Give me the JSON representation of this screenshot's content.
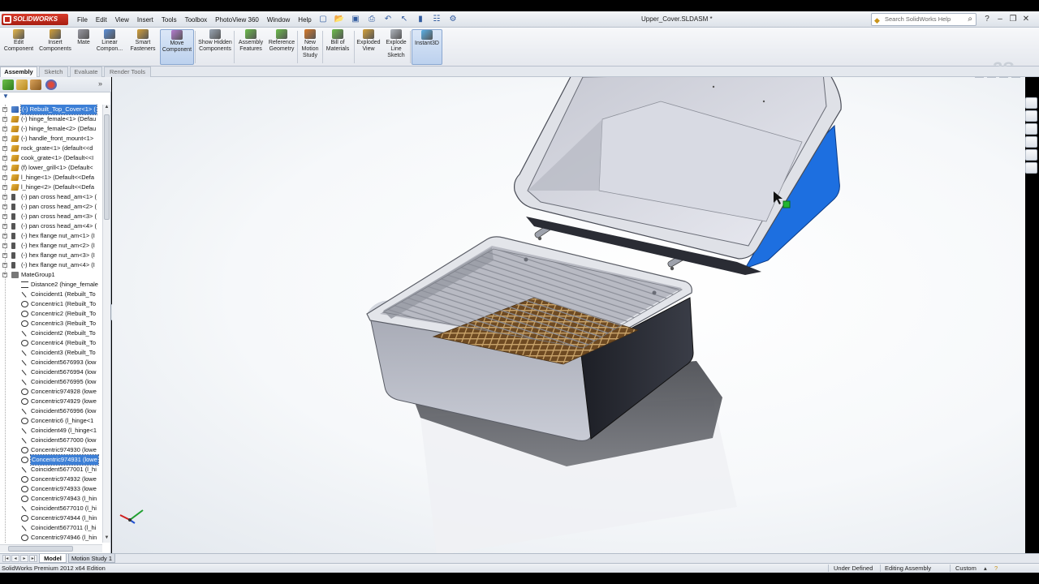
{
  "app": {
    "logo_text": "SOLIDWORKS",
    "document_title": "Upper_Cover.SLDASM *"
  },
  "menu": {
    "items": [
      "File",
      "Edit",
      "View",
      "Insert",
      "Tools",
      "Toolbox",
      "PhotoView 360",
      "Window",
      "Help"
    ]
  },
  "search": {
    "placeholder": "Search SolidWorks Help"
  },
  "command_manager": {
    "buttons": [
      {
        "label": "Edit Component",
        "icon": "edit-component-icon"
      },
      {
        "label": "Insert Components",
        "icon": "insert-components-icon"
      },
      {
        "label": "Mate",
        "icon": "mate-icon"
      },
      {
        "label": "Linear Compon...",
        "icon": "linear-pattern-icon"
      },
      {
        "label": "Smart Fasteners",
        "icon": "smart-fasteners-icon"
      },
      {
        "label": "Move Component",
        "icon": "move-component-icon"
      },
      {
        "label": "Show Hidden Components",
        "icon": "show-hidden-icon"
      },
      {
        "label": "Assembly Features",
        "icon": "assembly-features-icon"
      },
      {
        "label": "Reference Geometry",
        "icon": "reference-geometry-icon"
      },
      {
        "label": "New Motion Study",
        "icon": "motion-study-icon"
      },
      {
        "label": "Bill of Materials",
        "icon": "bom-icon"
      },
      {
        "label": "Exploded View",
        "icon": "exploded-view-icon"
      },
      {
        "label": "Explode Line Sketch",
        "icon": "explode-line-icon"
      },
      {
        "label": "Instant3D",
        "icon": "instant3d-icon"
      }
    ],
    "tabs": [
      "Assembly",
      "Sketch",
      "Evaluate",
      "Render Tools"
    ],
    "active_tab": "Assembly"
  },
  "feature_tree": {
    "rows": [
      {
        "label": "(-) Rebuilt_Top_Cover<1> (",
        "kind": "comp-blue",
        "depth": 1,
        "selected": true
      },
      {
        "label": "(-) hinge_female<1> (Defau",
        "kind": "comp",
        "depth": 1
      },
      {
        "label": "(-) hinge_female<2> (Defau",
        "kind": "comp",
        "depth": 1
      },
      {
        "label": "(-) handle_front_mount<1>",
        "kind": "comp",
        "depth": 1
      },
      {
        "label": "rock_grate<1> (default<<d",
        "kind": "comp",
        "depth": 1
      },
      {
        "label": "cook_grate<1> (Default<<I",
        "kind": "comp",
        "depth": 1
      },
      {
        "label": "(f) lower_grill<1> (Default<",
        "kind": "comp",
        "depth": 1
      },
      {
        "label": "l_hinge<1> (Default<<Defa",
        "kind": "comp",
        "depth": 1
      },
      {
        "label": "l_hinge<2> (Default<<Defa",
        "kind": "comp",
        "depth": 1
      },
      {
        "label": "(-) pan cross head_am<1> (",
        "kind": "screw",
        "depth": 1
      },
      {
        "label": "(-) pan cross head_am<2> (",
        "kind": "screw",
        "depth": 1
      },
      {
        "label": "(-) pan cross head_am<3> (",
        "kind": "screw",
        "depth": 1
      },
      {
        "label": "(-) pan cross head_am<4> (",
        "kind": "screw",
        "depth": 1
      },
      {
        "label": "(-) hex flange nut_am<1> (I",
        "kind": "screw",
        "depth": 1
      },
      {
        "label": "(-) hex flange nut_am<2> (I",
        "kind": "screw",
        "depth": 1
      },
      {
        "label": "(-) hex flange nut_am<3> (I",
        "kind": "screw",
        "depth": 1
      },
      {
        "label": "(-) hex flange nut_am<4> (I",
        "kind": "screw",
        "depth": 1
      },
      {
        "label": "MateGroup1",
        "kind": "group",
        "depth": 0
      },
      {
        "label": "Distance2 (hinge_female",
        "kind": "dist",
        "depth": 2
      },
      {
        "label": "Coincident1 (Rebuilt_To",
        "kind": "coin",
        "depth": 2
      },
      {
        "label": "Concentric1 (Rebuilt_To",
        "kind": "conc",
        "depth": 2
      },
      {
        "label": "Concentric2 (Rebuilt_To",
        "kind": "conc",
        "depth": 2
      },
      {
        "label": "Concentric3 (Rebuilt_To",
        "kind": "conc",
        "depth": 2
      },
      {
        "label": "Coincident2 (Rebuilt_To",
        "kind": "coin",
        "depth": 2
      },
      {
        "label": "Concentric4 (Rebuilt_To",
        "kind": "conc",
        "depth": 2
      },
      {
        "label": "Coincident3 (Rebuilt_To",
        "kind": "coin",
        "depth": 2
      },
      {
        "label": "Coincident5676993 (low",
        "kind": "coin",
        "depth": 2
      },
      {
        "label": "Coincident5676994 (low",
        "kind": "coin",
        "depth": 2
      },
      {
        "label": "Coincident5676995 (low",
        "kind": "coin",
        "depth": 2
      },
      {
        "label": "Concentric974928 (lowe",
        "kind": "conc",
        "depth": 2
      },
      {
        "label": "Concentric974929 (lowe",
        "kind": "conc",
        "depth": 2
      },
      {
        "label": "Coincident5676996 (low",
        "kind": "coin",
        "depth": 2
      },
      {
        "label": "Concentric6 (l_hinge<1",
        "kind": "conc",
        "depth": 2
      },
      {
        "label": "Coincident49 (l_hinge<1",
        "kind": "coin",
        "depth": 2
      },
      {
        "label": "Coincident5677000 (low",
        "kind": "coin",
        "depth": 2
      },
      {
        "label": "Concentric974930 (lowe",
        "kind": "conc",
        "depth": 2
      },
      {
        "label": "Concentric974931 (lowe",
        "kind": "conc",
        "depth": 2,
        "selected": true
      },
      {
        "label": "Coincident5677001 (l_hi",
        "kind": "coin",
        "depth": 2
      },
      {
        "label": "Concentric974932 (lowe",
        "kind": "conc",
        "depth": 2
      },
      {
        "label": "Concentric974933 (lowe",
        "kind": "conc",
        "depth": 2
      },
      {
        "label": "Concentric974943 (l_hin",
        "kind": "conc",
        "depth": 2
      },
      {
        "label": "Coincident5677010 (l_hi",
        "kind": "coin",
        "depth": 2
      },
      {
        "label": "Concentric974944 (l_hin",
        "kind": "conc",
        "depth": 2
      },
      {
        "label": "Coincident5677011 (l_hi",
        "kind": "coin",
        "depth": 2
      },
      {
        "label": "Concentric974946 (l_hin",
        "kind": "conc",
        "depth": 2
      }
    ]
  },
  "bottom_tabs": {
    "model": "Model",
    "motion_study": "Motion Study 1"
  },
  "status": {
    "edition": "SolidWorks Premium 2012 x64 Edition",
    "definition": "Under Defined",
    "mode": "Editing Assembly",
    "units": "Custom"
  },
  "colors": {
    "selection_blue": "#3c7fd6",
    "lid_accent": "#1d6fe0",
    "logo_red": "#c2271a"
  }
}
